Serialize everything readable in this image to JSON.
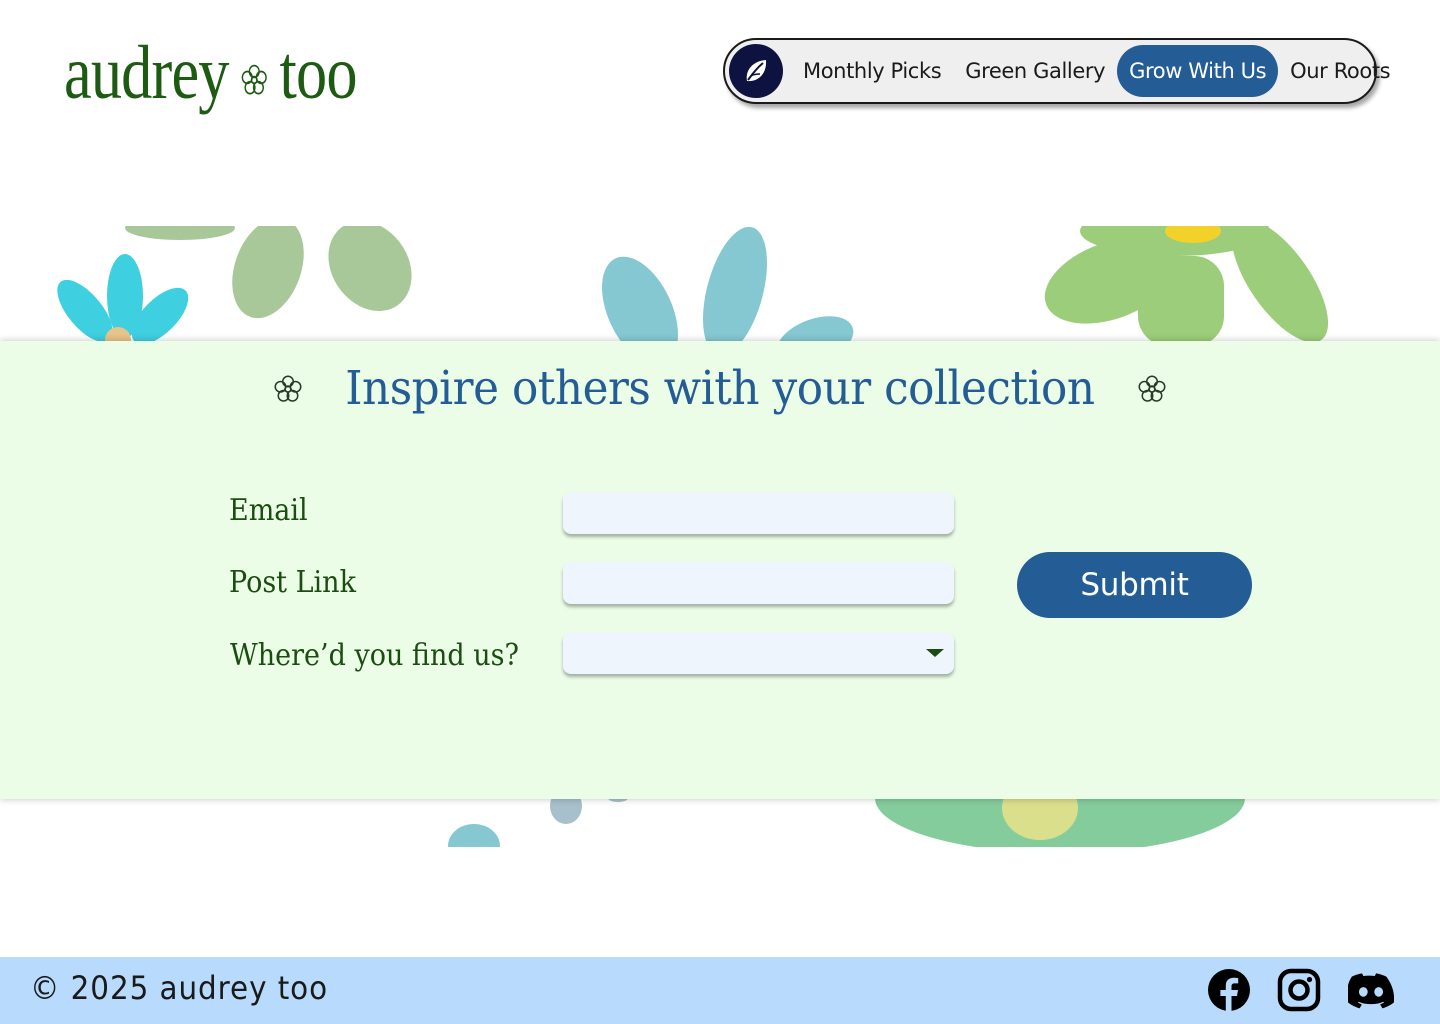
{
  "header": {
    "logo_left": "audrey",
    "logo_right": "too",
    "logo_color": "#1d5a12",
    "home_icon": "leaf-icon",
    "nav": [
      {
        "label": "Monthly Picks",
        "active": false
      },
      {
        "label": "Green Gallery",
        "active": false
      },
      {
        "label": "Grow With Us",
        "active": true
      },
      {
        "label": "Our Roots",
        "active": false
      }
    ]
  },
  "form": {
    "title": "Inspire others with your collection",
    "fields": {
      "email": {
        "label": "Email",
        "value": "",
        "placeholder": ""
      },
      "post_link": {
        "label": "Post Link",
        "value": "",
        "placeholder": ""
      },
      "source": {
        "label": "Where’d you find us?",
        "selected": ""
      }
    },
    "submit_label": "Submit"
  },
  "footer": {
    "copyright": "© 2025 audrey too",
    "social": [
      "facebook-icon",
      "instagram-icon",
      "discord-icon"
    ]
  },
  "colors": {
    "accent": "#245c96",
    "panel_bg": "#ebfde6",
    "footer_bg": "#b8dafc",
    "label_text": "#1a4d10",
    "field_bg": "#eef5fd"
  }
}
